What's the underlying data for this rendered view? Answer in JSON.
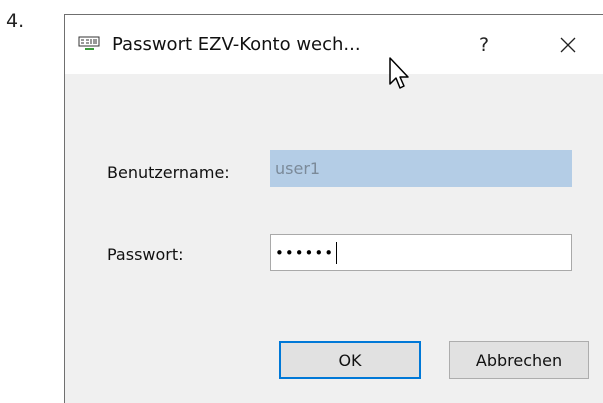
{
  "step": {
    "number": "4."
  },
  "dialog": {
    "title": "Passwort EZV-Konto wech...",
    "help_label": "?",
    "close_icon": "close-icon",
    "app_icon": "app-icon"
  },
  "form": {
    "username_label": "Benutzername:",
    "username_value": "user1",
    "password_label": "Passwort:",
    "password_value": "••••••"
  },
  "buttons": {
    "ok_label": "OK",
    "cancel_label": "Abbrechen"
  },
  "colors": {
    "accent": "#0078d7",
    "disabled_field": "#b4cde6",
    "dialog_bg": "#f0f0f0"
  }
}
